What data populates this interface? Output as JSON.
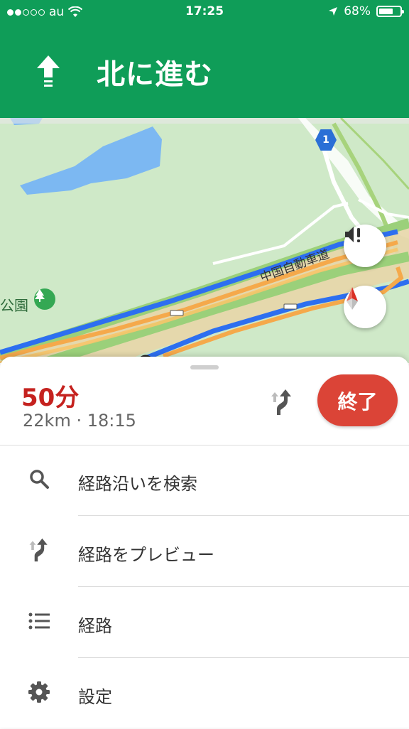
{
  "status_bar": {
    "carrier": "au",
    "time": "17:25",
    "battery_percent": "68%",
    "battery_level": 0.68,
    "signal_bars_filled": 2,
    "signal_bars_total": 5
  },
  "navigation": {
    "instruction": "北に進む",
    "direction_icon": "arrow-up-icon"
  },
  "map": {
    "route_shield": "1",
    "road_label": "中国自動車道",
    "park_label": "公園",
    "sound_button_icon": "sound-alert-icon",
    "compass_icon": "compass-icon"
  },
  "trip": {
    "eta_time": "50分",
    "eta_detail": "22km · 18:15",
    "end_label": "終了"
  },
  "menu": {
    "items": [
      {
        "label": "経路沿いを検索",
        "icon": "search-icon"
      },
      {
        "label": "経路をプレビュー",
        "icon": "route-preview-icon"
      },
      {
        "label": "経路",
        "icon": "list-icon"
      },
      {
        "label": "設定",
        "icon": "gear-icon"
      }
    ]
  },
  "colors": {
    "header_green": "#0f9d58",
    "end_button_red": "#db4437",
    "eta_red": "#c5221f",
    "route_blue": "#2d6ff0"
  }
}
